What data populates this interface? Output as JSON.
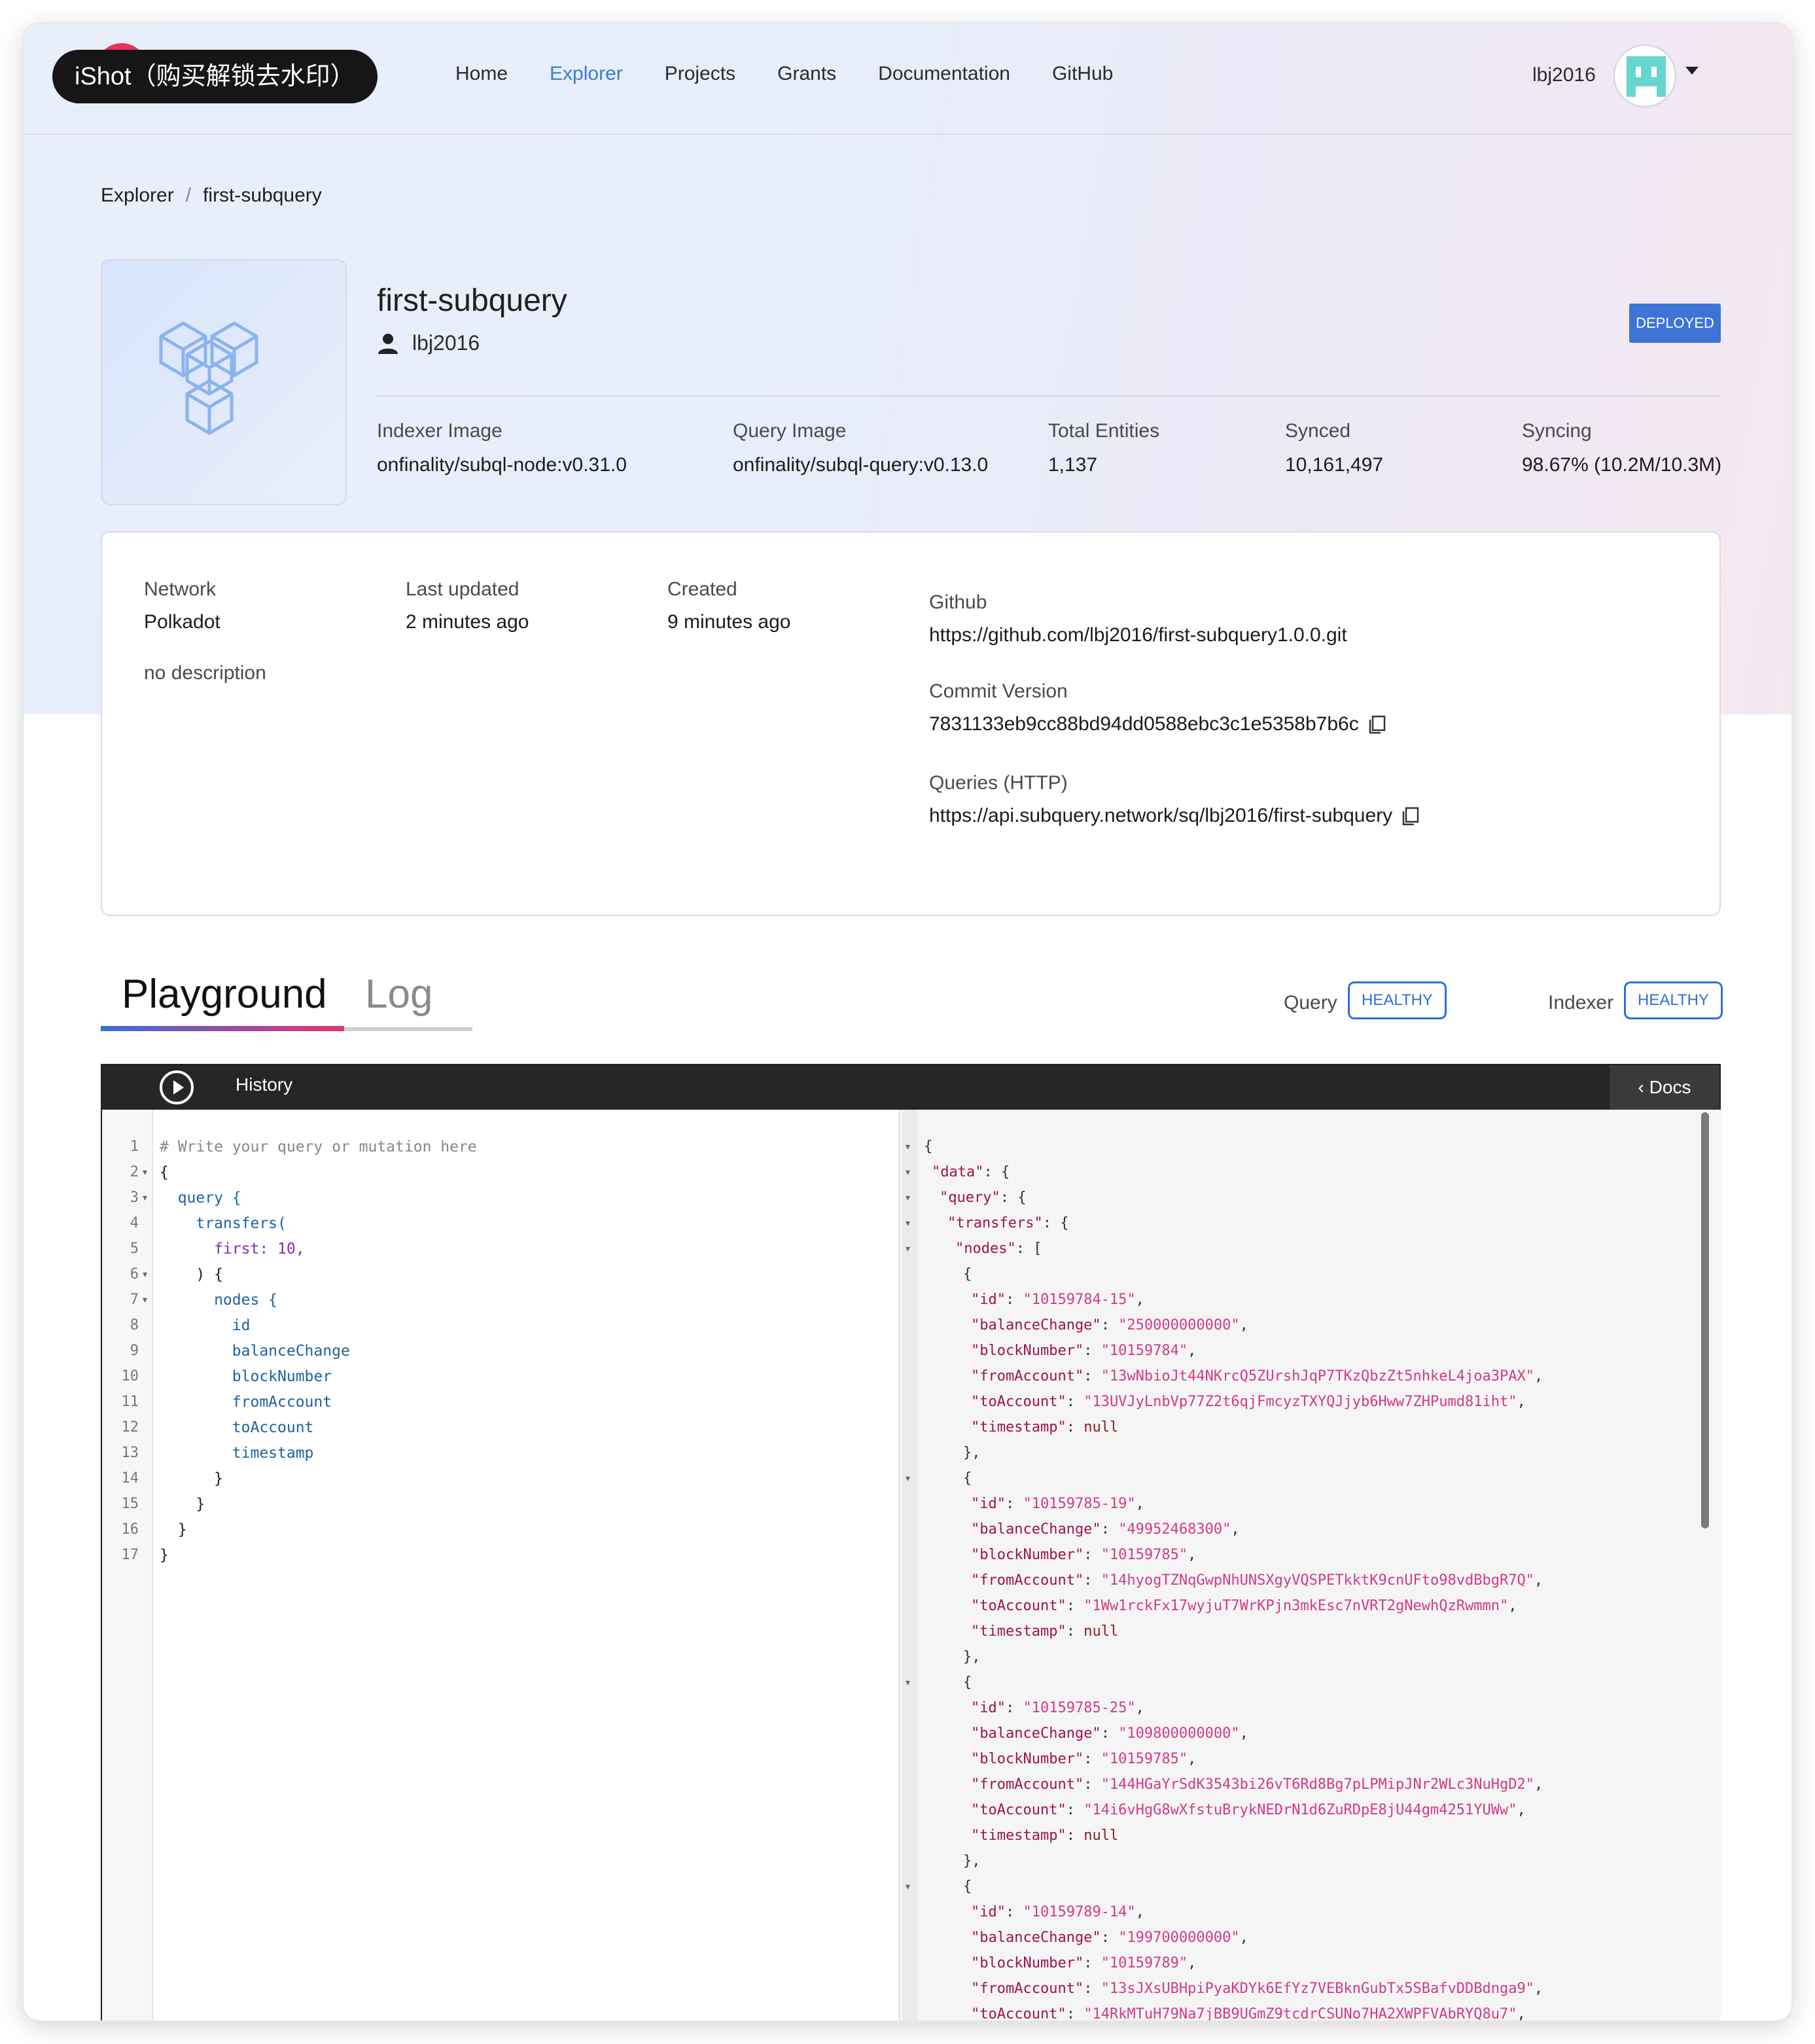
{
  "watermark": "iShot（购买解锁去水印）",
  "nav": {
    "links": [
      "Home",
      "Explorer",
      "Projects",
      "Grants",
      "Documentation",
      "GitHub"
    ],
    "active": "Explorer",
    "user": "lbj2016"
  },
  "breadcrumb": {
    "root": "Explorer",
    "sep": "/",
    "current": "first-subquery"
  },
  "project": {
    "name": "first-subquery",
    "owner": "lbj2016",
    "status": "DEPLOYED",
    "stats": [
      {
        "label": "Indexer Image",
        "value": "onfinality/subql-node:v0.31.0"
      },
      {
        "label": "Query Image",
        "value": "onfinality/subql-query:v0.13.0"
      },
      {
        "label": "Total Entities",
        "value": "1,137"
      },
      {
        "label": "Synced",
        "value": "10,161,497"
      },
      {
        "label": "Syncing",
        "value": "98.67% (10.2M/10.3M)"
      }
    ]
  },
  "info": {
    "network_label": "Network",
    "network": "Polkadot",
    "updated_label": "Last updated",
    "updated": "2 minutes ago",
    "created_label": "Created",
    "created": "9 minutes ago",
    "description": "no description",
    "github_label": "Github",
    "github": "https://github.com/lbj2016/first-subquery1.0.0.git",
    "commit_label": "Commit Version",
    "commit": "7831133eb9cc88bd94dd0588ebc3c1e5358b7b6c",
    "queries_label": "Queries (HTTP)",
    "queries": "https://api.subquery.network/sq/lbj2016/first-subquery"
  },
  "tabs": {
    "playground": "Playground",
    "log": "Log"
  },
  "health": {
    "query_label": "Query",
    "query_status": "HEALTHY",
    "indexer_label": "Indexer",
    "indexer_status": "HEALTHY"
  },
  "playground": {
    "history": "History",
    "docs": "Docs",
    "query_lines": [
      "# Write your query or mutation here",
      "{",
      "  query {",
      "    transfers(",
      "      first: 10,",
      "    ) {",
      "      nodes {",
      "        id",
      "        balanceChange",
      "        blockNumber",
      "        fromAccount",
      "        toAccount",
      "        timestamp",
      "      }",
      "    }",
      "  }",
      "}"
    ],
    "result_nodes": [
      {
        "id": "10159784-15",
        "balanceChange": "250000000000",
        "blockNumber": "10159784",
        "fromAccount": "13wNbioJt44NKrcQ5ZUrshJqP7TKzQbzZt5nhkeL4joa3PAX",
        "toAccount": "13UVJyLnbVp77Z2t6qjFmcyzTXYQJjyb6Hww7ZHPumd81iht",
        "timestamp": "null"
      },
      {
        "id": "10159785-19",
        "balanceChange": "49952468300",
        "blockNumber": "10159785",
        "fromAccount": "14hyogTZNqGwpNhUNSXgyVQSPETkktK9cnUFto98vdBbgR7Q",
        "toAccount": "1Ww1rckFx17wyjuT7WrKPjn3mkEsc7nVRT2gNewhQzRwmmn",
        "timestamp": "null"
      },
      {
        "id": "10159785-25",
        "balanceChange": "109800000000",
        "blockNumber": "10159785",
        "fromAccount": "144HGaYrSdK3543bi26vT6Rd8Bg7pLPMipJNr2WLc3NuHgD2",
        "toAccount": "14i6vHgG8wXfstuBrykNEDrN1d6ZuRDpE8jU44gm4251YUWw",
        "timestamp": "null"
      },
      {
        "id": "10159789-14",
        "balanceChange": "199700000000",
        "blockNumber": "10159789",
        "fromAccount": "13sJXsUBHpiPyaKDYk6EfYz7VEBknGubTx5SBafvDDBdnga9",
        "toAccount": "14RkMTuH79Na7jBB9UGmZ9tcdrCSUNo7HA2XWPFVAbRYQ8u7",
        "timestamp": "null"
      }
    ]
  },
  "colors": {
    "accent": "#3a7bd5",
    "badge": "#3d74d6",
    "healthy": "#2f6fde"
  }
}
